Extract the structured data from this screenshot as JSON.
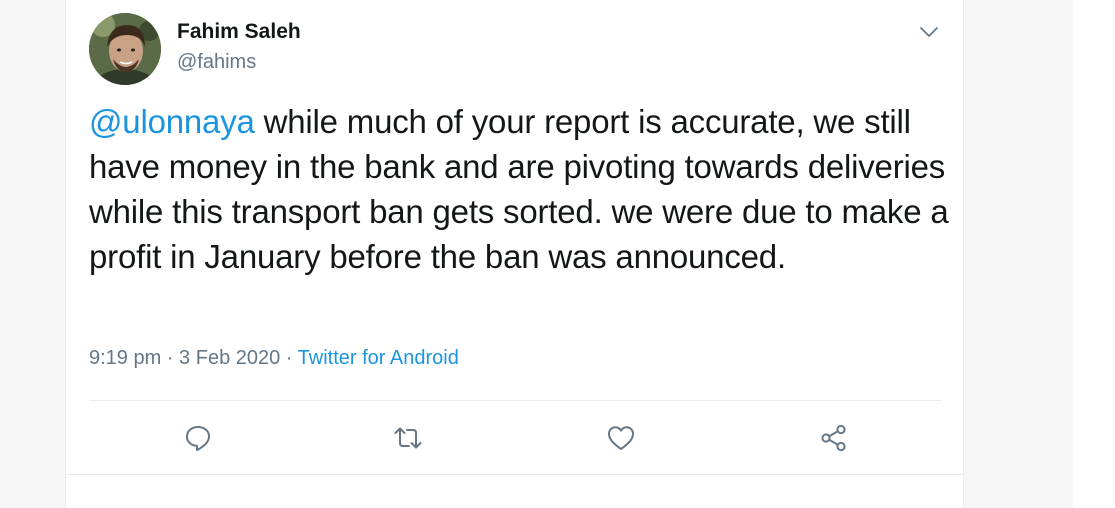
{
  "tweet": {
    "author": {
      "display_name": "Fahim Saleh",
      "handle": "@fahims"
    },
    "body": {
      "mention": "@ulonnaya",
      "text": " while much of your report is accurate, we still have money in the bank and are pivoting towards deliveries while this transport ban gets sorted. we were due to make a profit in January before the ban was announced."
    },
    "meta": {
      "time": "9:19 pm",
      "separator_1": " · ",
      "date": "3 Feb 2020",
      "separator_2": " · ",
      "source": "Twitter for Android"
    },
    "actions": {
      "reply_icon": "reply-icon",
      "retweet_icon": "retweet-icon",
      "like_icon": "heart-icon",
      "share_icon": "share-icon"
    },
    "more_icon": "chevron-down-icon"
  },
  "colors": {
    "text": "#14171a",
    "secondary": "#657786",
    "link": "#1b95e0",
    "border": "#e6ecf0",
    "icon": "#657786"
  }
}
